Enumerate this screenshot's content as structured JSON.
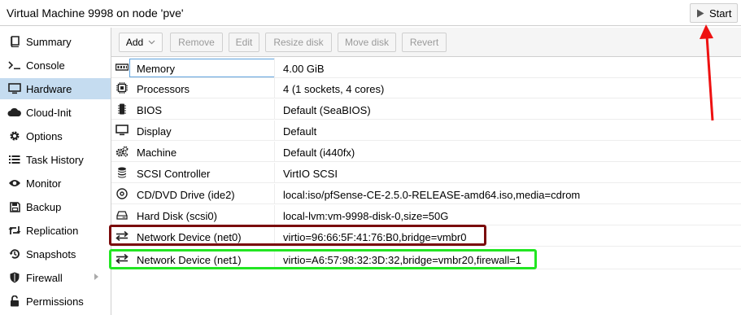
{
  "window": {
    "title": "Virtual Machine 9998 on node 'pve'",
    "start_label": "Start"
  },
  "sidebar": {
    "items": [
      {
        "label": "Summary",
        "icon": "book-icon"
      },
      {
        "label": "Console",
        "icon": "terminal-icon"
      },
      {
        "label": "Hardware",
        "icon": "monitor-icon",
        "active": true
      },
      {
        "label": "Cloud-Init",
        "icon": "cloud-icon"
      },
      {
        "label": "Options",
        "icon": "gear-icon"
      },
      {
        "label": "Task History",
        "icon": "list-icon"
      },
      {
        "label": "Monitor",
        "icon": "eye-icon"
      },
      {
        "label": "Backup",
        "icon": "floppy-icon"
      },
      {
        "label": "Replication",
        "icon": "retweet-icon"
      },
      {
        "label": "Snapshots",
        "icon": "history-icon"
      },
      {
        "label": "Firewall",
        "icon": "shield-icon"
      },
      {
        "label": "Permissions",
        "icon": "unlock-icon"
      }
    ]
  },
  "toolbar": {
    "add_label": "Add",
    "remove_label": "Remove",
    "edit_label": "Edit",
    "resize_label": "Resize disk",
    "move_label": "Move disk",
    "revert_label": "Revert"
  },
  "hardware": {
    "rows": [
      {
        "name": "Memory",
        "value": "4.00 GiB",
        "icon": "memory-icon"
      },
      {
        "name": "Processors",
        "value": "4 (1 sockets, 4 cores)",
        "icon": "cpu-icon"
      },
      {
        "name": "BIOS",
        "value": "Default (SeaBIOS)",
        "icon": "microchip-icon"
      },
      {
        "name": "Display",
        "value": "Default",
        "icon": "desktop-icon"
      },
      {
        "name": "Machine",
        "value": "Default (i440fx)",
        "icon": "cogs-icon"
      },
      {
        "name": "SCSI Controller",
        "value": "VirtIO SCSI",
        "icon": "database-icon"
      },
      {
        "name": "CD/DVD Drive (ide2)",
        "value": "local:iso/pfSense-CE-2.5.0-RELEASE-amd64.iso,media=cdrom",
        "icon": "cdrom-icon"
      },
      {
        "name": "Hard Disk (scsi0)",
        "value": "local-lvm:vm-9998-disk-0,size=50G",
        "icon": "hdd-icon"
      },
      {
        "name": "Network Device (net0)",
        "value": "virtio=96:66:5F:41:76:B0,bridge=vmbr0",
        "icon": "exchange-icon"
      },
      {
        "name": "Network Device (net1)",
        "value": "virtio=A6:57:98:32:3D:32,bridge=vmbr20,firewall=1",
        "icon": "exchange-icon"
      }
    ]
  },
  "colors": {
    "highlight_net0": "#7a0a0a",
    "highlight_net1": "#22e622",
    "annotation_arrow": "#ee1111",
    "selected_nav": "#c5dcf0"
  }
}
